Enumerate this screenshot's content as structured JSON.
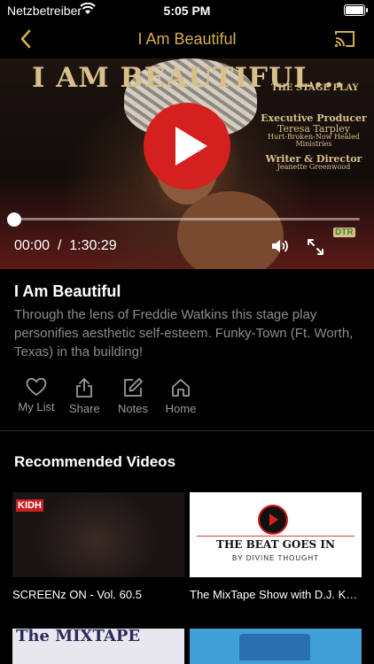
{
  "status_bar": {
    "carrier": "Netzbetreiber",
    "time": "5:05 PM"
  },
  "nav": {
    "title": "I Am Beautiful",
    "back_icon": "chevron-left-icon",
    "cast_icon": "cast-icon",
    "accent": "#d6ad4f"
  },
  "player": {
    "poster_title": "I AM BEAUTIFUL...",
    "poster_subtitle": "THE STAGE PLAY",
    "credits": {
      "exec_heading": "Executive Producer",
      "exec_name": "Teresa Tarpley",
      "exec_tagline": "Hurt-Broken-Now Healed Ministries",
      "writer_heading": "Writer & Director",
      "writer_name": "Jeanette Greenwood"
    },
    "logo_text": "DTR",
    "current_time": "00:00",
    "separator": "/",
    "duration": "1:30:29",
    "progress": 0,
    "play_color": "#d4201f"
  },
  "video": {
    "title": "I Am Beautiful",
    "description": "Through the lens of Freddie Watkins this stage play personifies aesthetic self-esteem. Funky-Town (Ft. Worth, Texas) in tha building!"
  },
  "actions": [
    {
      "label": "My List",
      "icon": "heart-icon"
    },
    {
      "label": "Share",
      "icon": "share-icon"
    },
    {
      "label": "Notes",
      "icon": "edit-icon"
    },
    {
      "label": "Home",
      "icon": "home-icon"
    }
  ],
  "recommended": {
    "heading": "Recommended Videos",
    "items": [
      {
        "title": "SCREENz ON - Vol. 60.5",
        "thumb_logo": "KIDH"
      },
      {
        "title": "The MixTape Show with D.J. Kane",
        "thumb_line1": "THE BEAT GOES IN",
        "thumb_line2": "BY DIVINE THOUGHT"
      },
      {
        "title": "",
        "thumb_word": "The MIXTAPE"
      },
      {
        "title": ""
      }
    ]
  }
}
